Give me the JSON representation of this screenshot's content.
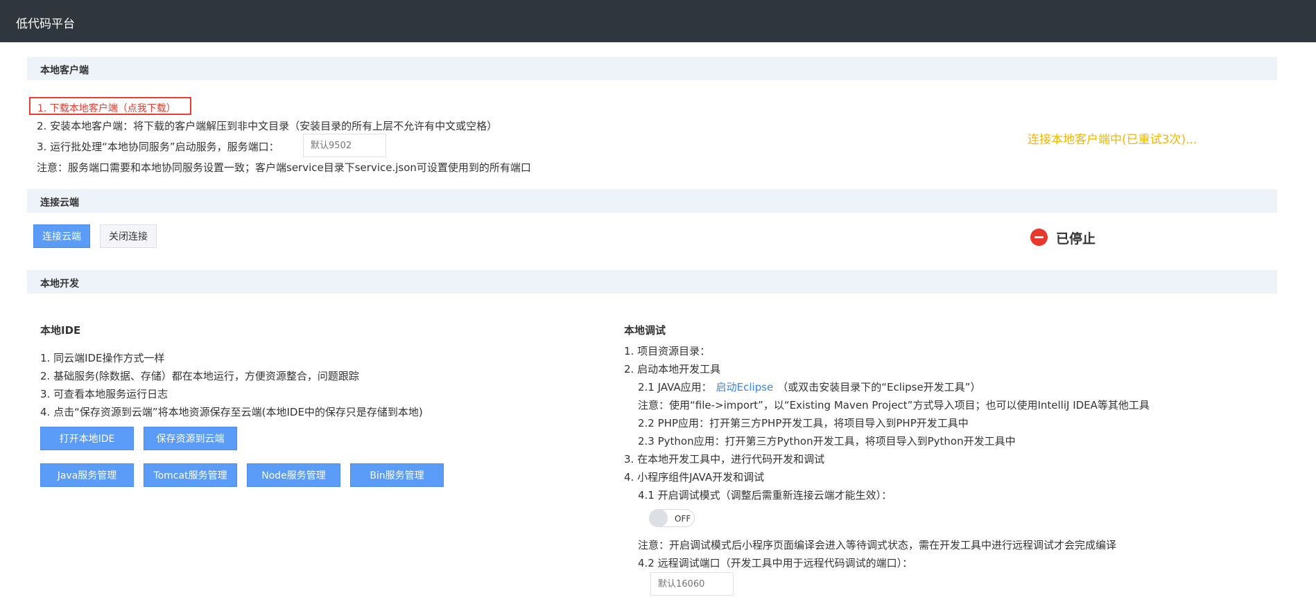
{
  "app": {
    "title": "低代码平台"
  },
  "local_client": {
    "section_title": "本地客户端",
    "step1": "1. 下载本地客户端（点我下载）",
    "step2": "2. 安装本地客户端：将下载的客户端解压到非中文目录（安装目录的所有上层不允许有中文或空格）",
    "step3": "3. 运行批处理“本地协同服务”启动服务，服务端口：",
    "port_placeholder": "默认9502",
    "note": "注意：服务端口需要和本地协同服务设置一致；客户端service目录下service.json可设置使用到的所有端口",
    "status": "连接本地客户端中(已重试3次)..."
  },
  "cloud": {
    "section_title": "连接云端",
    "connect_label": "连接云端",
    "close_label": "关闭连接",
    "status": "已停止",
    "status_color": "#e8372c"
  },
  "local_dev": {
    "section_title": "本地开发",
    "ide": {
      "title": "本地IDE",
      "items": [
        "1. 同云端IDE操作方式一样",
        "2. 基础服务(除数据、存储）都在本地运行，方便资源整合，问题跟踪",
        "3. 可查看本地服务运行日志",
        "4. 点击“保存资源到云端”将本地资源保存至云端(本地IDE中的保存只是存储到本地)"
      ],
      "buttons": {
        "open_ide": "打开本地IDE",
        "save_cloud": "保存资源到云端",
        "java": "Java服务管理",
        "tomcat": "Tomcat服务管理",
        "node": "Node服务管理",
        "bin": "Bin服务管理"
      }
    },
    "debug": {
      "title": "本地调试",
      "item1": "1. 项目资源目录：",
      "item2": "2. 启动本地开发工具",
      "item2_1_prefix": "2.1 JAVA应用：",
      "item2_1_link": "启动Eclipse",
      "item2_1_suffix": "（或双击安装目录下的“Eclipse开发工具”）",
      "item2_1_note": "注意：使用“file->import”，以“Existing Maven Project”方式导入项目；也可以使用IntelliJ IDEA等其他工具",
      "item2_2": "2.2 PHP应用：打开第三方PHP开发工具，将项目导入到PHP开发工具中",
      "item2_3": "2.3 Python应用：打开第三方Python开发工具，将项目导入到Python开发工具中",
      "item3": "3. 在本地开发工具中，进行代码开发和调试",
      "item4": "4. 小程序组件JAVA开发和调试",
      "item4_1": "4.1 开启调试模式（调整后需重新连接云端才能生效）：",
      "toggle_label": "OFF",
      "item4_1_note": "注意：开启调试模式后小程序页面编译会进入等待调式状态，需在开发工具中进行远程调试才会完成编译",
      "item4_2": "4.2 远程调试端口（开发工具中用于远程代码调试的端口）：",
      "debug_port_placeholder": "默认16060"
    }
  }
}
